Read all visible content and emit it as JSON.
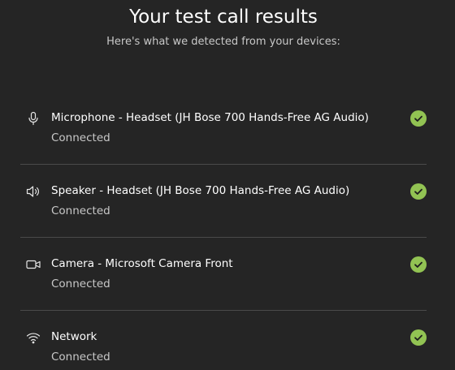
{
  "header": {
    "title": "Your test call results",
    "subtitle": "Here's what we detected from your devices:"
  },
  "colors": {
    "background": "#252525",
    "success": "#92c353",
    "divider": "#4a4a4a"
  },
  "devices": [
    {
      "icon": "microphone-icon",
      "label": "Microphone - Headset (JH Bose 700 Hands-Free AG Audio)",
      "status": "Connected"
    },
    {
      "icon": "speaker-icon",
      "label": "Speaker - Headset (JH Bose 700 Hands-Free AG Audio)",
      "status": "Connected"
    },
    {
      "icon": "camera-icon",
      "label": "Camera - Microsoft Camera Front",
      "status": "Connected"
    },
    {
      "icon": "wifi-icon",
      "label": "Network",
      "status": "Connected"
    }
  ]
}
